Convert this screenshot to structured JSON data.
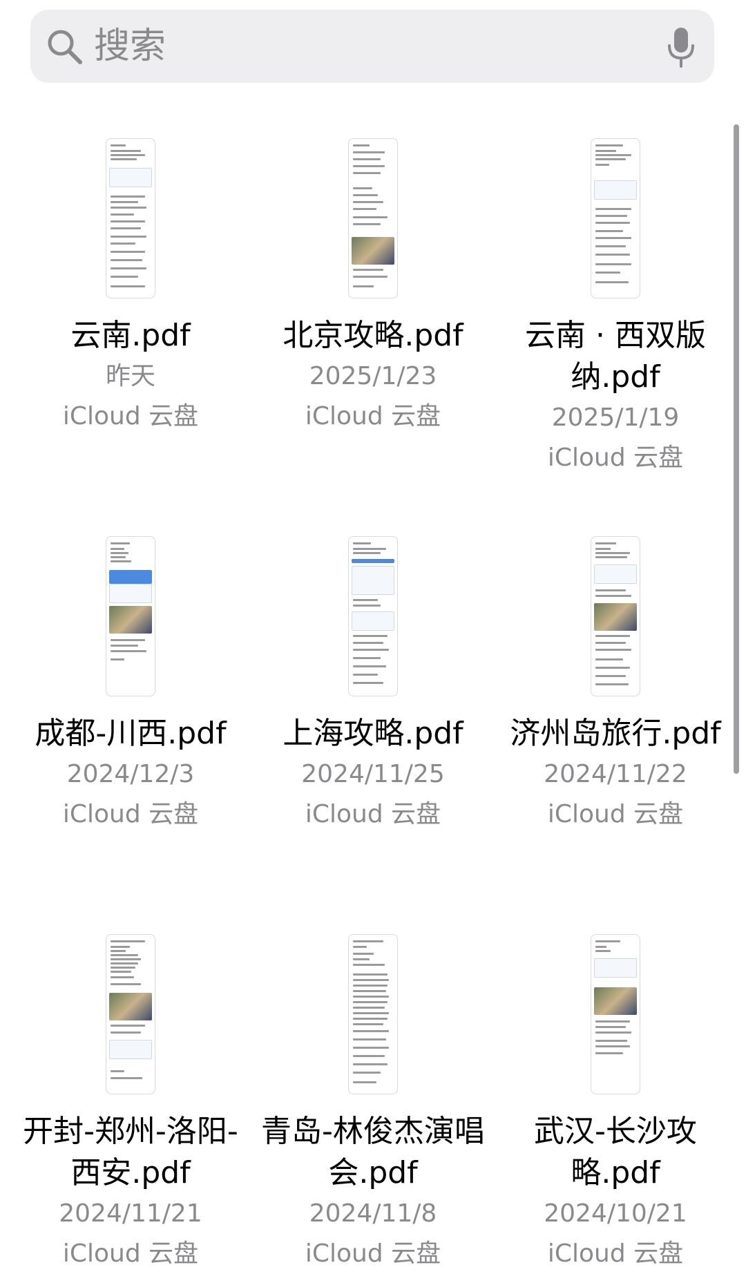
{
  "search": {
    "placeholder": "搜索"
  },
  "files": [
    {
      "name": "云南.pdf",
      "date": "昨天",
      "location": "iCloud 云盘"
    },
    {
      "name": "北京攻略.pdf",
      "date": "2025/1/23",
      "location": "iCloud 云盘"
    },
    {
      "name": "云南 · 西双版纳.pdf",
      "date": "2025/1/19",
      "location": "iCloud 云盘"
    },
    {
      "name": "成都-川西.pdf",
      "date": "2024/12/3",
      "location": "iCloud 云盘"
    },
    {
      "name": "上海攻略.pdf",
      "date": "2024/11/25",
      "location": "iCloud 云盘"
    },
    {
      "name": "济州岛旅行.pdf",
      "date": "2024/11/22",
      "location": "iCloud 云盘"
    },
    {
      "name": "开封-郑州-洛阳-西安.pdf",
      "date": "2024/11/21",
      "location": "iCloud 云盘"
    },
    {
      "name": "青岛-林俊杰演唱会.pdf",
      "date": "2024/11/8",
      "location": "iCloud 云盘"
    },
    {
      "name": "武汉-长沙攻略.pdf",
      "date": "2024/10/21",
      "location": "iCloud 云盘"
    }
  ]
}
